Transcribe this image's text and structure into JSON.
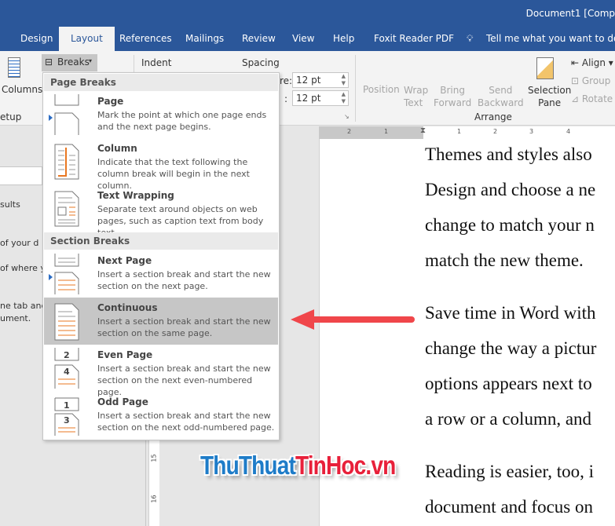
{
  "window": {
    "title": "Document1 [Comp"
  },
  "tabs": [
    "Design",
    "Layout",
    "References",
    "Mailings",
    "Review",
    "View",
    "Help",
    "Foxit Reader PDF"
  ],
  "active_tab": "Layout",
  "tell_me": "Tell me what you want to do",
  "ribbon": {
    "columns": "Columns",
    "page_setup": "etup",
    "breaks": "Breaks",
    "indent": "Indent",
    "spacing": "Spacing",
    "before_label": "re:",
    "before_value": "12 pt",
    "after_label": ":",
    "after_value": "12 pt",
    "position": "Position",
    "wrap_text": [
      "Wrap",
      "Text"
    ],
    "bring_forward": [
      "Bring",
      "Forward"
    ],
    "send_backward": [
      "Send",
      "Backward"
    ],
    "selection_pane": [
      "Selection",
      "Pane"
    ],
    "align": "Align",
    "group": "Group",
    "rotate": "Rotate",
    "arrange": "Arrange"
  },
  "nav_pane": {
    "lines": [
      "sults",
      "of your d",
      "of where y",
      "ne tab and",
      "ument."
    ]
  },
  "ruler": {
    "h": [
      "2",
      "1",
      "1",
      "2",
      "3",
      "4"
    ],
    "v": [
      "15",
      "16"
    ]
  },
  "menu": {
    "page_breaks": "Page Breaks",
    "section_breaks": "Section Breaks",
    "items": [
      {
        "title": "Page",
        "desc": "Mark the point at which one page ends and the next page begins."
      },
      {
        "title": "Column",
        "desc": "Indicate that the text following the column break will begin in the next column."
      },
      {
        "title": "Text Wrapping",
        "desc": "Separate text around objects on web pages, such as caption text from body text."
      },
      {
        "title": "Next Page",
        "desc": "Insert a section break and start the new section on the next page."
      },
      {
        "title": "Continuous",
        "desc": "Insert a section break and start the new section on the same page."
      },
      {
        "title": "Even Page",
        "desc": "Insert a section break and start the new section on the next even-numbered page."
      },
      {
        "title": "Odd Page",
        "desc": "Insert a section break and start the new section on the next odd-numbered page."
      }
    ],
    "selected": "Continuous"
  },
  "document": {
    "lines": [
      "Themes and styles also",
      "Design and choose a ne",
      "change to match your n",
      "match the new theme.",
      "Save time in Word with",
      "change the way a pictur",
      "options appears next to",
      "a row or a column, and",
      "Reading is easier, too, i",
      "document and focus on"
    ]
  },
  "watermark": {
    "part1": "ThuThuat",
    "part2": "TinHoc.vn",
    "color1": "#1e7cc8",
    "color2": "#e8203a"
  },
  "colors": {
    "brand": "#2b579a",
    "arrow": "#f0464a",
    "selected": "#c6c6c6"
  }
}
